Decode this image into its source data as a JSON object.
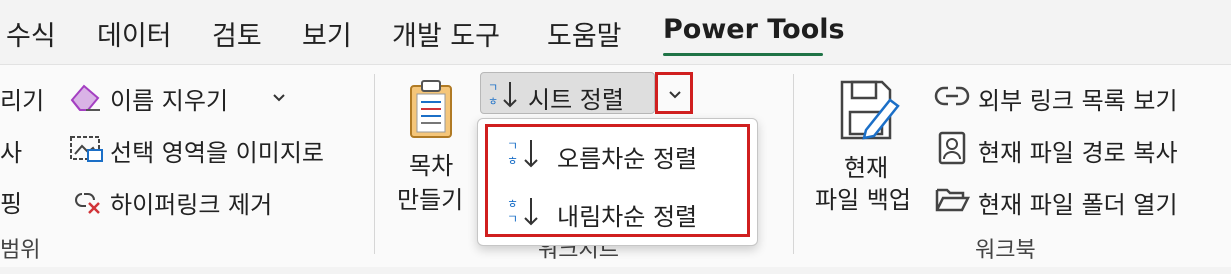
{
  "menubar": {
    "tabs": [
      "수식",
      "데이터",
      "검토",
      "보기",
      "개발 도구",
      "도움말",
      "Power Tools"
    ]
  },
  "left_group": {
    "partial_items": [
      "리기",
      "사",
      "핑",
      "범위"
    ]
  },
  "links_group": {
    "clear_name_label": "이름 지우기",
    "selection_image_label": "선택 영역을 이미지로",
    "remove_hyperlink_label": "하이퍼링크 제거"
  },
  "worksheet_group": {
    "toc_label_line1": "목차",
    "toc_label_line2": "만들기",
    "sort_sheet_label": "시트 정렬",
    "group_label": "워크시트",
    "sort_menu": {
      "ascending_label": "오름차순 정렬",
      "descending_label": "내림차순 정렬"
    }
  },
  "workbook_group": {
    "backup_label_line1": "현재",
    "backup_label_line2": "파일 백업",
    "external_links_label": "외부 링크 목록 보기",
    "copy_path_label": "현재 파일 경로 복사",
    "open_folder_label": "현재 파일 폴더 열기",
    "group_label": "워크북"
  },
  "colors": {
    "accent_underline": "#1f7346",
    "highlight_border": "#d01f1f",
    "clear_icon_purple": "#a43fc2",
    "remove_link_red": "#d13438",
    "sort_icon_blue": "#1b6fc7"
  }
}
